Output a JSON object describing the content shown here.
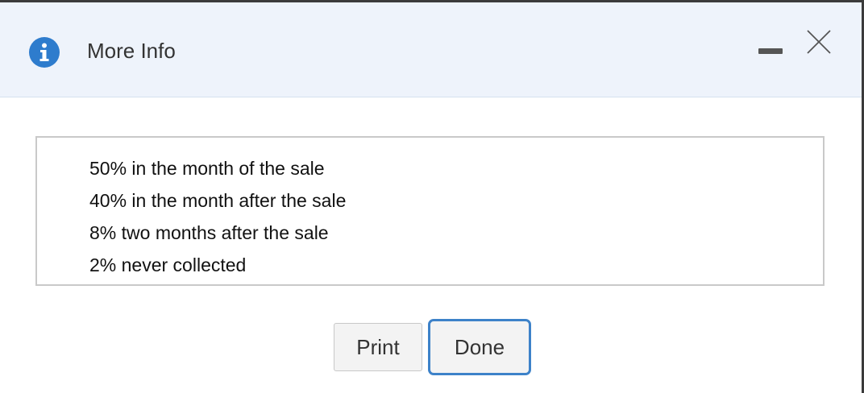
{
  "dialog": {
    "title": "More Info",
    "icons": {
      "info": "info-icon",
      "minimize": "minimize-icon",
      "close": "close-icon"
    },
    "items": [
      "50% in the month of the sale",
      "40% in the month after the sale",
      "8% two months after the sale",
      "2% never collected"
    ],
    "buttons": {
      "print_label": "Print",
      "done_label": "Done"
    },
    "colors": {
      "header_bg": "#eef3fb",
      "accent": "#2e7ccd",
      "focus_border": "#3d82c9"
    }
  }
}
